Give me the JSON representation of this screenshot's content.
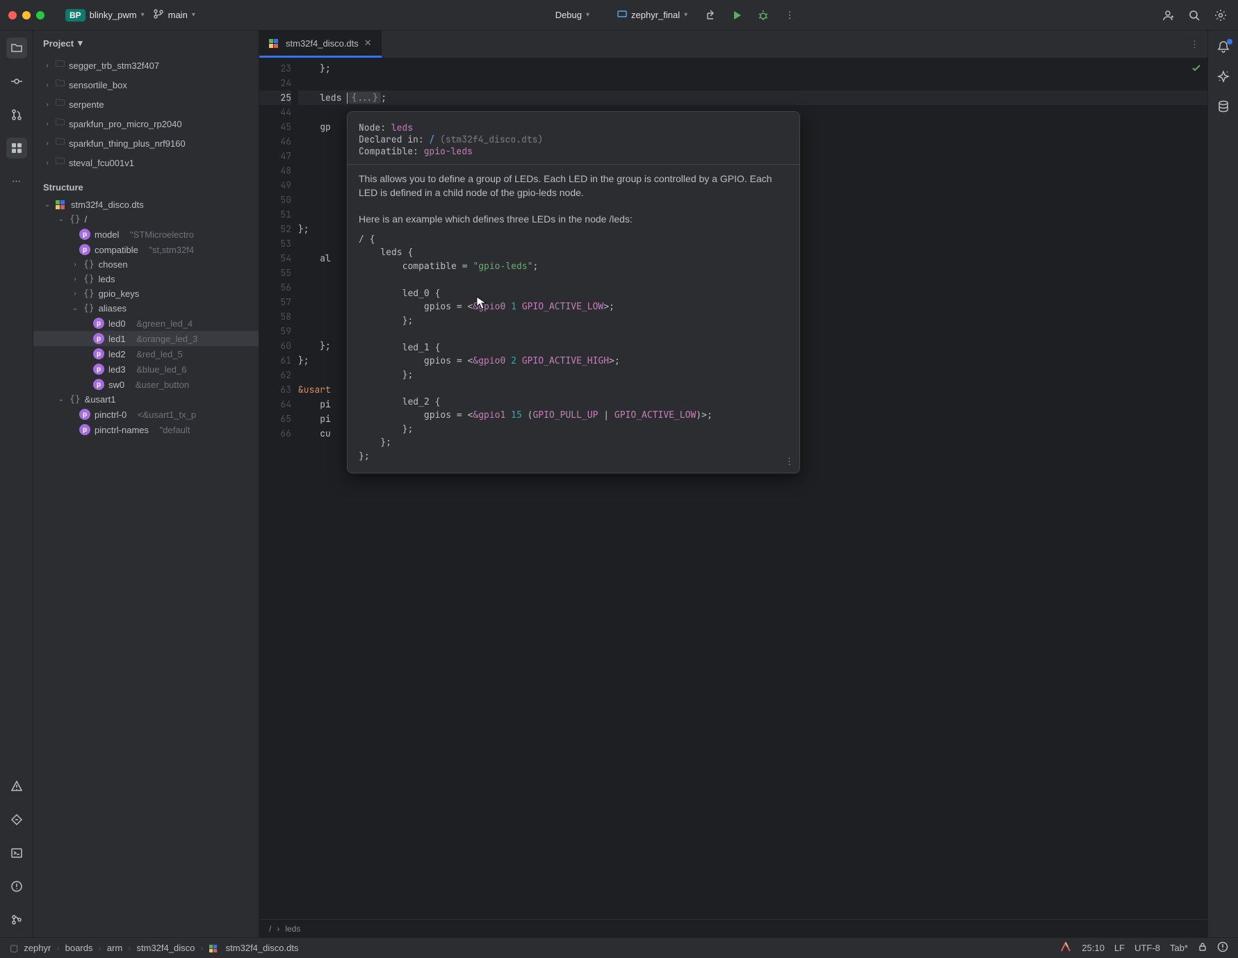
{
  "titlebar": {
    "project_name": "blinky_pwm",
    "branch": "main",
    "run_config": "Debug",
    "target": "zephyr_final"
  },
  "sidebar": {
    "project_label": "Project",
    "folders": [
      "segger_trb_stm32f407",
      "sensortile_box",
      "serpente",
      "sparkfun_pro_micro_rp2040",
      "sparkfun_thing_plus_nrf9160",
      "steval_fcu001v1"
    ],
    "structure_label": "Structure",
    "structure_root": "stm32f4_disco.dts",
    "root_slash": "/",
    "nodes": {
      "model": {
        "name": "model",
        "val": "\"STMicroelectro"
      },
      "compatible": {
        "name": "compatible",
        "val": "\"st,stm32f4"
      },
      "chosen": "chosen",
      "leds": "leds",
      "gpio_keys": "gpio_keys",
      "aliases": "aliases",
      "led0": {
        "name": "led0",
        "val": "&green_led_4"
      },
      "led1": {
        "name": "led1",
        "val": "&orange_led_3"
      },
      "led2": {
        "name": "led2",
        "val": "&red_led_5"
      },
      "led3": {
        "name": "led3",
        "val": "&blue_led_6"
      },
      "sw0": {
        "name": "sw0",
        "val": "&user_button"
      },
      "usart1": "&usart1",
      "pinctrl0": {
        "name": "pinctrl-0",
        "val": "<&usart1_tx_p"
      },
      "pinctrl_names": {
        "name": "pinctrl-names",
        "val": "\"default"
      }
    }
  },
  "tab": {
    "file": "stm32f4_disco.dts"
  },
  "gutter_lines": [
    "23",
    "24",
    "25",
    "44",
    "45",
    "46",
    "47",
    "48",
    "49",
    "50",
    "51",
    "52",
    "53",
    "54",
    "55",
    "56",
    "57",
    "58",
    "59",
    "60",
    "61",
    "62",
    "63",
    "64",
    "65",
    "66"
  ],
  "code": {
    "l23": "    };",
    "l24": "",
    "l25a": "    leds ",
    "l25b": "{...}",
    "l25c": ";",
    "l44": "",
    "l45": "    gp",
    "l52": "};",
    "l54": "    al",
    "l60": "    };",
    "l61": "};",
    "l63": "&usart",
    "l64": "    pi",
    "l65": "    pi",
    "l66": "    cu"
  },
  "popup": {
    "node_label": "Node: ",
    "node_val": "leds",
    "decl_label": "Declared in: ",
    "decl_val": "/",
    "decl_file": "(stm32f4_disco.dts)",
    "compat_label": "Compatible: ",
    "compat_val": "gpio-leds",
    "doc1": "This allows you to define a group of LEDs. Each LED in the group is controlled by a GPIO. Each LED is defined in a child node of the gpio-leds node.",
    "doc2": "Here is an example which defines three LEDs in the node /leds:",
    "example": "/ {\n    leds {\n        compatible = \"gpio-leds\";\n\n        led_0 {\n            gpios = <&gpio0 1 GPIO_ACTIVE_LOW>;\n        };\n\n        led_1 {\n            gpios = <&gpio0 2 GPIO_ACTIVE_HIGH>;\n        };\n\n        led_2 {\n            gpios = <&gpio1 15 (GPIO_PULL_UP | GPIO_ACTIVE_LOW)>;\n        };\n    };\n};"
  },
  "breadcrumb": {
    "p1": "/",
    "p2": "leds"
  },
  "statusbar": {
    "crumbs": [
      "zephyr",
      "boards",
      "arm",
      "stm32f4_disco",
      "stm32f4_disco.dts"
    ],
    "pos": "25:10",
    "eol": "LF",
    "enc": "UTF-8",
    "indent": "Tab*"
  }
}
